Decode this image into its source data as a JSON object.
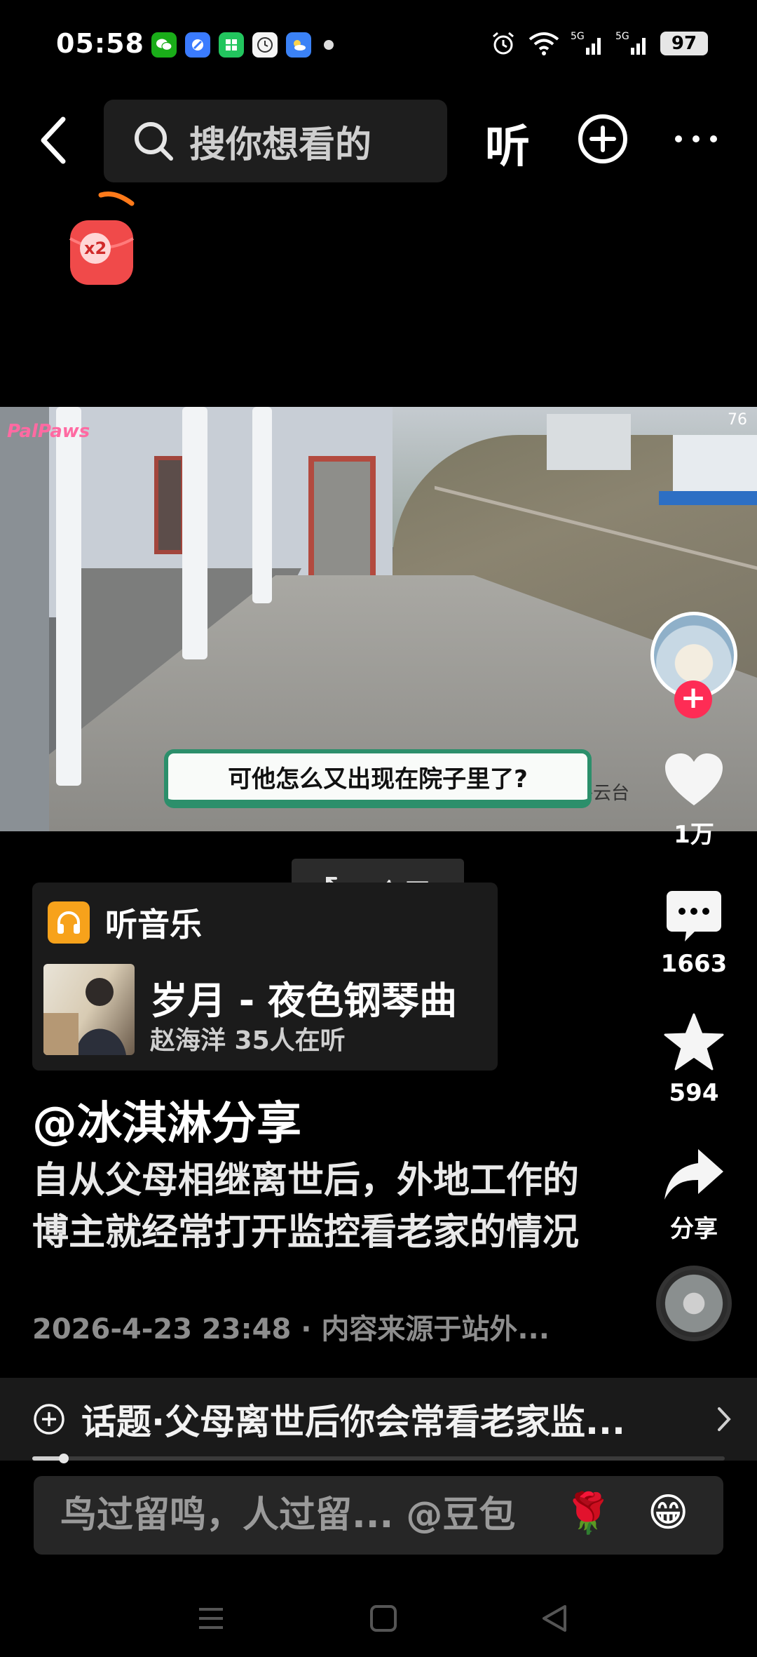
{
  "status_bar": {
    "time": "05:58",
    "battery": "97",
    "network": "5G"
  },
  "top_nav": {
    "search_placeholder": "搜你想看的",
    "listen_label": "听"
  },
  "redpacket": {
    "badge": "x2"
  },
  "video": {
    "logo": "PalPaws",
    "signal_text": "76",
    "caption": "可他怎么又出现在院子里了?",
    "watermark": "外云台"
  },
  "actions": {
    "likes": "1万",
    "comments": "1663",
    "favorites": "594",
    "share": "分享"
  },
  "fullscreen": {
    "label": "全屏"
  },
  "music_card": {
    "header": "听音乐",
    "song": "岁月 - 夜色钢琴曲",
    "artist_line": "赵海洋 35人在听"
  },
  "post": {
    "author": "@冰淇淋分享",
    "description": "自从父母相继离世后，外地工作的博主就经常打开监控看老家的情况",
    "meta": "2026-4-23 23:48 · 内容来源于站外..."
  },
  "topic": {
    "text": "话题·父母离世后你会常看老家监..."
  },
  "progress": {
    "fraction": 0.046
  },
  "comment_bar": {
    "placeholder": "鸟过留鸣，人过留... @豆包"
  },
  "colors": {
    "accent_red": "#fe2c55",
    "caption_green": "#2c8f6b",
    "music_orange": "#f7a21b"
  }
}
